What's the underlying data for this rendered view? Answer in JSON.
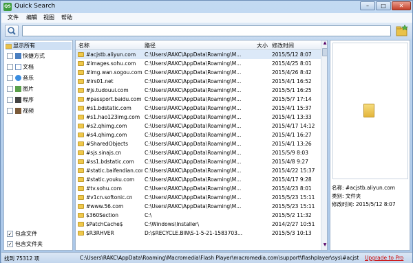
{
  "window": {
    "title": "Quick Search",
    "app_icon_text": "QS"
  },
  "menu": [
    "文件",
    "编辑",
    "视图",
    "帮助"
  ],
  "search": {
    "value": "",
    "placeholder": ""
  },
  "filters": {
    "show_all": "显示所有",
    "items": [
      {
        "label": "快捷方式",
        "icon": "shortcut-icon",
        "color": "#4a7fc1"
      },
      {
        "label": "文档",
        "icon": "document-icon",
        "color": "#6b8fbf"
      },
      {
        "label": "音乐",
        "icon": "music-icon",
        "color": "#3a8de0"
      },
      {
        "label": "图片",
        "icon": "picture-icon",
        "color": "#5aa04a"
      },
      {
        "label": "程序",
        "icon": "program-icon",
        "color": "#444"
      },
      {
        "label": "视频",
        "icon": "video-icon",
        "color": "#7a5a3a"
      }
    ],
    "include_files": "包含文件",
    "include_folders": "包含文件夹"
  },
  "table": {
    "columns": {
      "name": "名称",
      "path": "路径",
      "size": "大小",
      "mtime": "修改时间"
    },
    "rows": [
      {
        "name": "#acjstb.aliyun.com",
        "path": "C:\\Users\\RAKC\\AppData\\Roaming\\M...",
        "size": "",
        "mtime": "2015/5/12 8:07"
      },
      {
        "name": "#images.sohu.com",
        "path": "C:\\Users\\RAKC\\AppData\\Roaming\\M...",
        "size": "",
        "mtime": "2015/4/25 8:01"
      },
      {
        "name": "#img.wan.sogou.com",
        "path": "C:\\Users\\RAKC\\AppData\\Roaming\\M...",
        "size": "",
        "mtime": "2015/4/26 8:42"
      },
      {
        "name": "#irs01.net",
        "path": "C:\\Users\\RAKC\\AppData\\Roaming\\M...",
        "size": "",
        "mtime": "2015/4/1 16:52"
      },
      {
        "name": "#js.tudouui.com",
        "path": "C:\\Users\\RAKC\\AppData\\Roaming\\M...",
        "size": "",
        "mtime": "2015/5/1 16:25"
      },
      {
        "name": "#passport.baidu.com",
        "path": "C:\\Users\\RAKC\\AppData\\Roaming\\M...",
        "size": "",
        "mtime": "2015/5/7 17:14"
      },
      {
        "name": "#s1.bdstatic.com",
        "path": "C:\\Users\\RAKC\\AppData\\Roaming\\M...",
        "size": "",
        "mtime": "2015/4/1 15:37"
      },
      {
        "name": "#s1.hao123img.com",
        "path": "C:\\Users\\RAKC\\AppData\\Roaming\\M...",
        "size": "",
        "mtime": "2015/4/1 13:33"
      },
      {
        "name": "#s2.qhimg.com",
        "path": "C:\\Users\\RAKC\\AppData\\Roaming\\M...",
        "size": "",
        "mtime": "2015/4/17 14:12"
      },
      {
        "name": "#s4.qhimg.com",
        "path": "C:\\Users\\RAKC\\AppData\\Roaming\\M...",
        "size": "",
        "mtime": "2015/4/1 16:27"
      },
      {
        "name": "#SharedObjects",
        "path": "C:\\Users\\RAKC\\AppData\\Roaming\\M...",
        "size": "",
        "mtime": "2015/4/1 13:26"
      },
      {
        "name": "#sjs.sinajs.cn",
        "path": "C:\\Users\\RAKC\\AppData\\Roaming\\M...",
        "size": "",
        "mtime": "2015/5/9 8:03"
      },
      {
        "name": "#ss1.bdstatic.com",
        "path": "C:\\Users\\RAKC\\AppData\\Roaming\\M...",
        "size": "",
        "mtime": "2015/4/8 9:27"
      },
      {
        "name": "#static.baifendian.com",
        "path": "C:\\Users\\RAKC\\AppData\\Roaming\\M...",
        "size": "",
        "mtime": "2015/4/22 15:37"
      },
      {
        "name": "#static.youku.com",
        "path": "C:\\Users\\RAKC\\AppData\\Roaming\\M...",
        "size": "",
        "mtime": "2015/4/17 9:28"
      },
      {
        "name": "#tv.sohu.com",
        "path": "C:\\Users\\RAKC\\AppData\\Roaming\\M...",
        "size": "",
        "mtime": "2015/4/23 8:01"
      },
      {
        "name": "#v1cn.softonic.cn",
        "path": "C:\\Users\\RAKC\\AppData\\Roaming\\M...",
        "size": "",
        "mtime": "2015/5/23 15:11"
      },
      {
        "name": "#www.56.com",
        "path": "C:\\Users\\RAKC\\AppData\\Roaming\\M...",
        "size": "",
        "mtime": "2015/5/23 15:11"
      },
      {
        "name": "$360Section",
        "path": "C:\\",
        "size": "",
        "mtime": "2015/5/2 11:32"
      },
      {
        "name": "$PatchCache$",
        "path": "C:\\Windows\\Installer\\",
        "size": "",
        "mtime": "2014/2/27 10:51"
      },
      {
        "name": "$R3RHVER",
        "path": "D:\\$RECYCLE.BIN\\S-1-5-21-1583703...",
        "size": "",
        "mtime": "2015/5/3 10:13"
      },
      {
        "name": "",
        "path": "",
        "size": "",
        "mtime": ""
      }
    ]
  },
  "preview": {
    "name_label": "名称:",
    "name": "#acjstb.aliyun.com",
    "type_label": "类别:",
    "type": "文件夹",
    "mtime_label": "修改时间:",
    "mtime": "2015/5/12 8:07"
  },
  "status": {
    "found": "找到 75312 项",
    "path": "C:\\Users\\RAKC\\AppData\\Roaming\\Macromedia\\Flash Player\\macromedia.com\\support\\flashplayer\\sys\\#acjstb.aliyun.com",
    "upgrade": "Upgrade to Pro"
  }
}
